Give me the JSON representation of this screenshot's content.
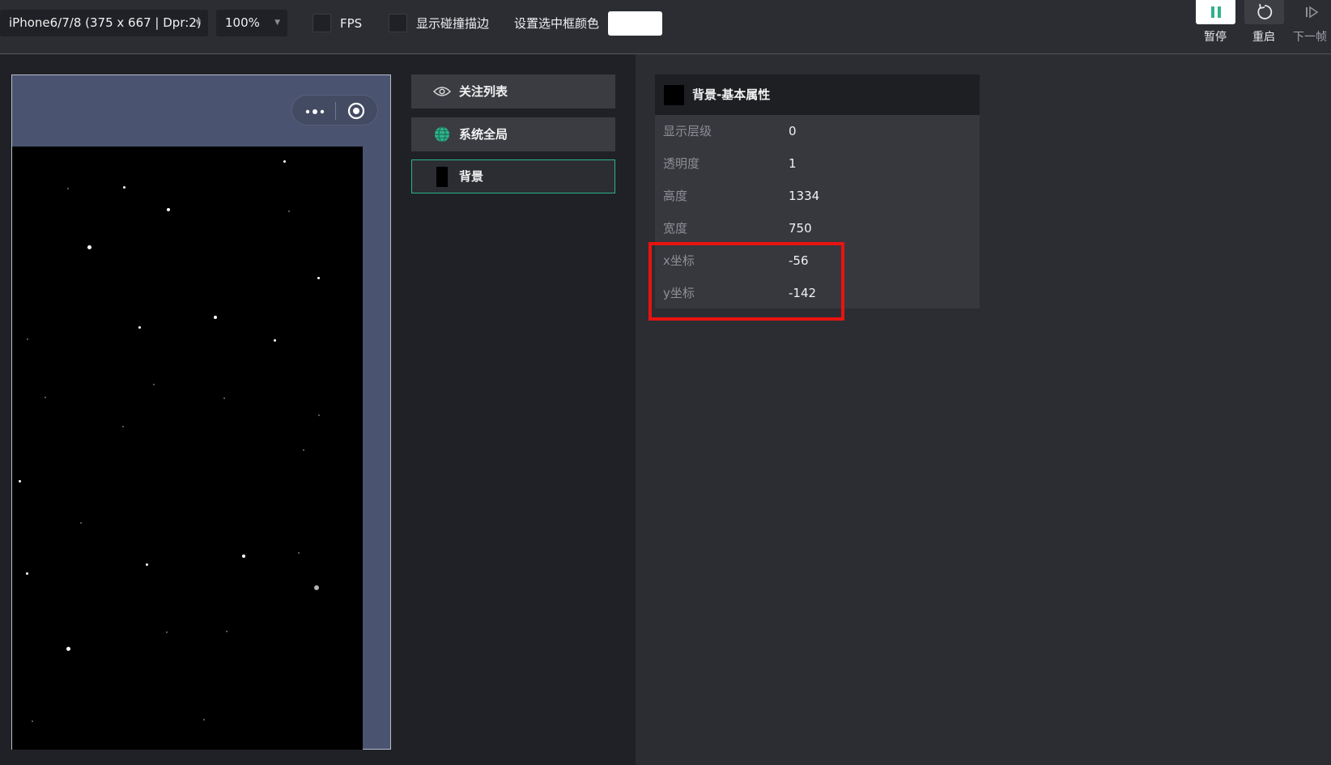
{
  "toolbar": {
    "device_select": "iPhone6/7/8 (375 x 667 | Dpr:2)",
    "zoom_select": "100%",
    "fps_label": "FPS",
    "collision_label": "显示碰撞描边",
    "frame_color_label": "设置选中框颜色",
    "frame_color": "#ffffff",
    "pause_label": "暂停",
    "restart_label": "重启",
    "next_frame_label": "下一帧"
  },
  "node_list": [
    {
      "label": "关注列表",
      "icon": "eye-icon"
    },
    {
      "label": "系统全局",
      "icon": "globe-icon"
    },
    {
      "label": "背景",
      "icon": "background-thumbnail-icon"
    }
  ],
  "properties": {
    "title": "背景-基本属性",
    "rows": [
      {
        "key": "显示层级",
        "value": "0"
      },
      {
        "key": "透明度",
        "value": "1"
      },
      {
        "key": "高度",
        "value": "1334"
      },
      {
        "key": "宽度",
        "value": "750"
      },
      {
        "key": "x坐标",
        "value": "-56"
      },
      {
        "key": "y坐标",
        "value": "-142"
      }
    ]
  },
  "colors": {
    "accent": "#2fb38a",
    "highlight": "#e8130f"
  }
}
